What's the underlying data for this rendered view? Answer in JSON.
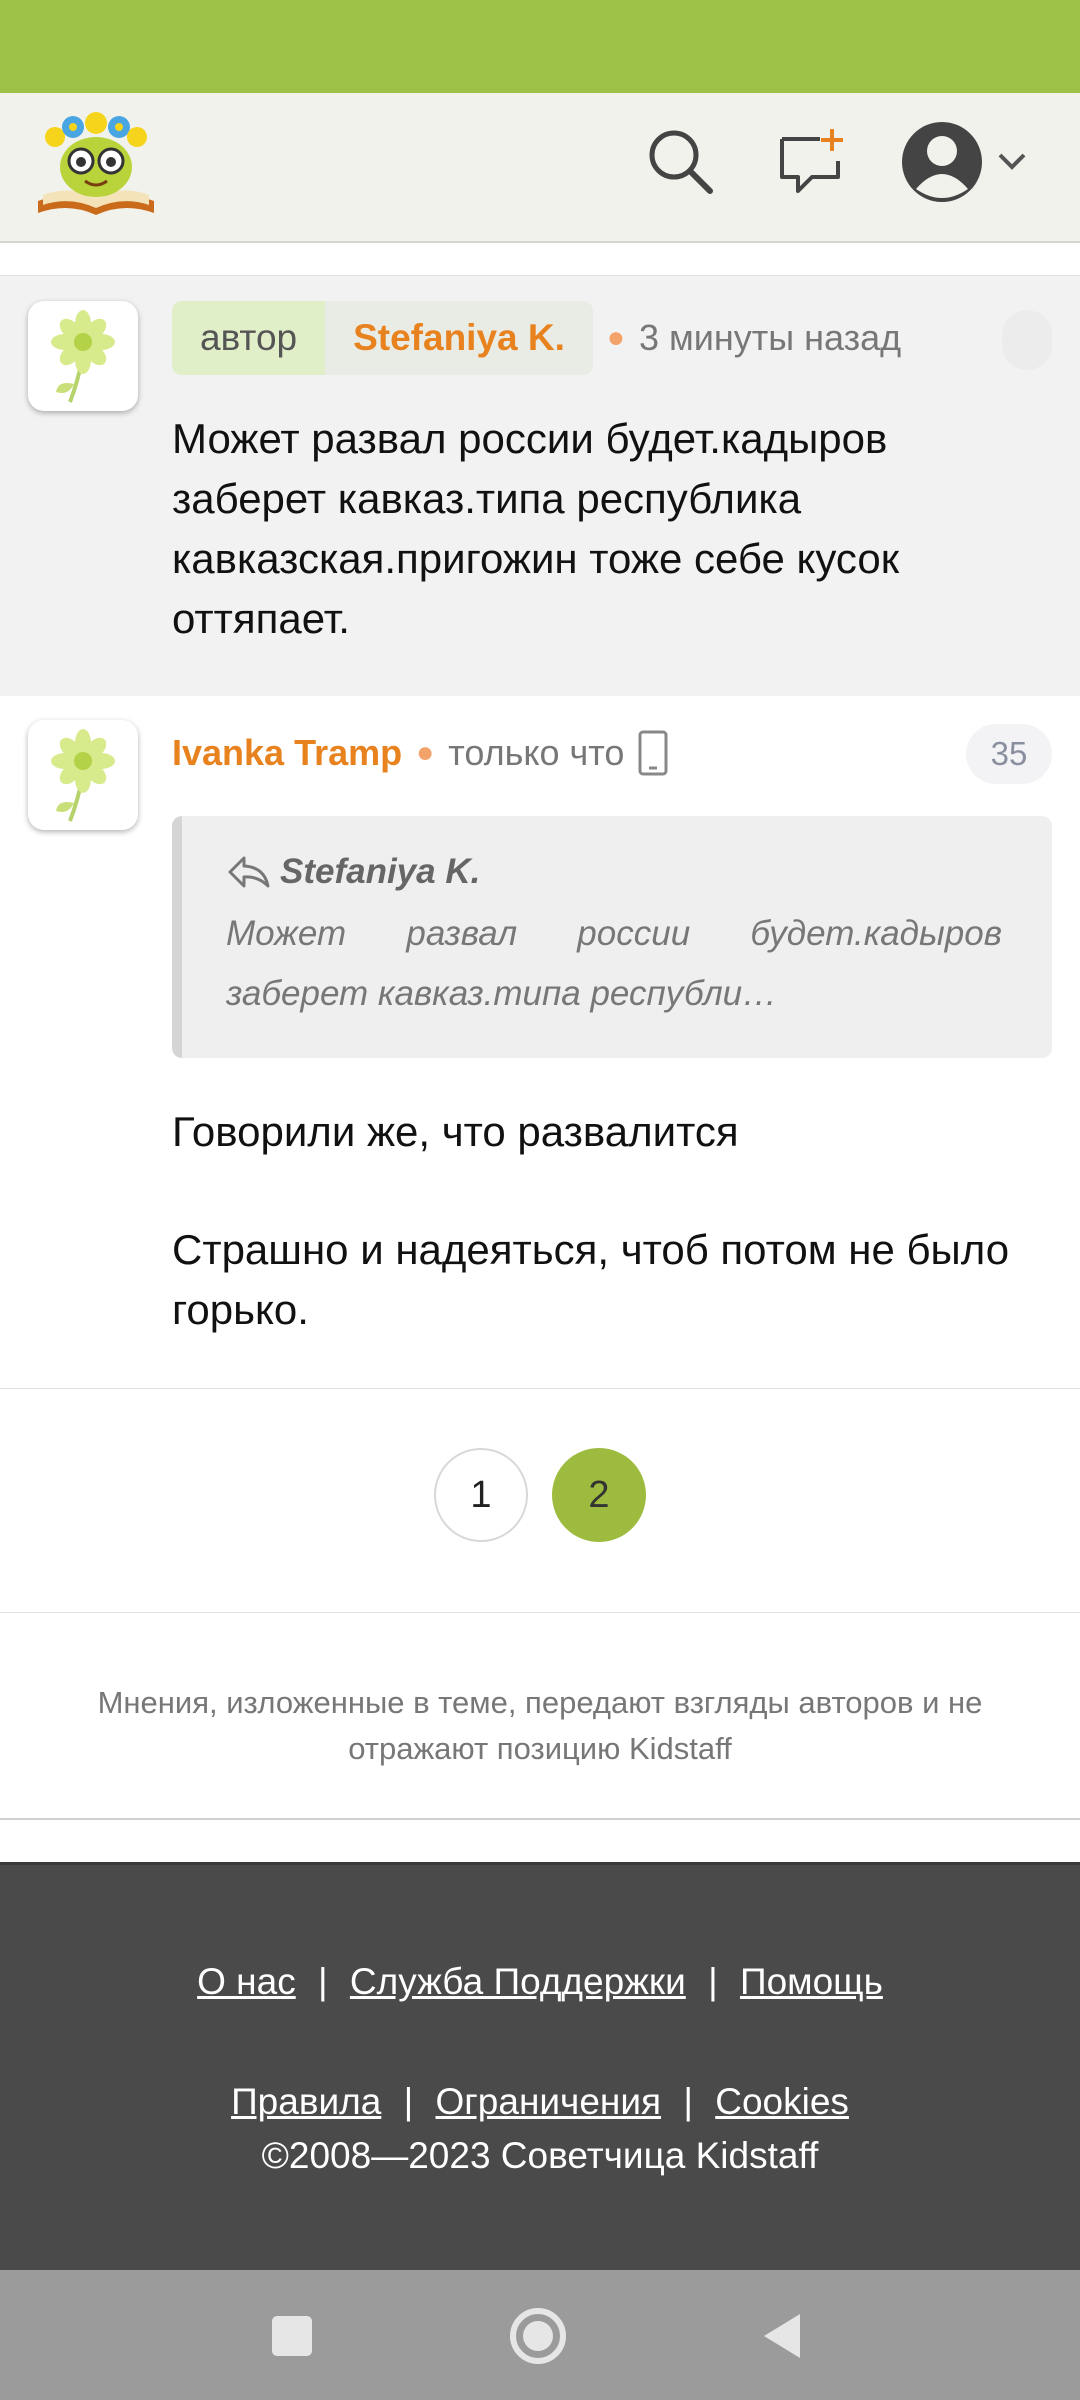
{
  "post1": {
    "role_label": "автор",
    "author": "Stefaniya K.",
    "time": "3 минуты назад",
    "text": "Может развал россии будет.кадыров заберет кавказ.типа республика кавказская.пригожин тоже себе кусок оттяпает."
  },
  "post2": {
    "author": "Ivanka Tramp",
    "time": "только что",
    "count": "35",
    "quote_author": "Stefaniya K.",
    "quote_text": "Может развал россии будет.кадыров заберет кавказ.типа республи…",
    "text_line1": "Говорили же, что развалится",
    "text_line2": "Страшно и надеяться, чтоб потом не было горько."
  },
  "pagination": {
    "pages": [
      "1",
      "2"
    ],
    "current": "2"
  },
  "disclaimer": "Мнения, изложенные в теме, передают взгляды авторов и не отражают позицию Kidstaff",
  "footer": {
    "links_row1": [
      "О нас",
      "Служба Поддержки",
      "Помощь"
    ],
    "links_row2": [
      "Правила",
      "Ограничения",
      "Cookies"
    ],
    "separator": "|",
    "copyright": "©2008—2023 Советчица Kidstaff"
  },
  "colors": {
    "accent_green": "#9dc146",
    "author_orange": "#e8821e",
    "footer_bg": "#4a4a4a"
  },
  "icons": [
    "kidstaff-logo",
    "search-icon",
    "new-message-icon",
    "user-avatar-icon",
    "chevron-down-icon",
    "reply-icon",
    "mobile-device-icon",
    "flower-avatar-icon",
    "nav-square-icon",
    "nav-home-icon",
    "nav-back-icon"
  ]
}
